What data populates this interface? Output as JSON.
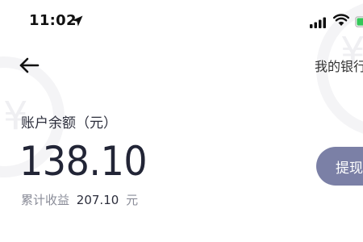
{
  "status_bar": {
    "time": "11:02",
    "icons": [
      "location-arrow-icon",
      "cellular-signal-icon",
      "wifi-icon",
      "battery-icon"
    ]
  },
  "nav": {
    "back_icon": "arrow-left-icon",
    "right_link": "我的银行"
  },
  "balance": {
    "label": "账户余额（元）",
    "amount": "138.10",
    "earnings_label": "累计收益",
    "earnings_value": "207.10",
    "earnings_unit": "元"
  },
  "actions": {
    "withdraw_label": "提现"
  },
  "colors": {
    "accent_button": "#7b80a6",
    "text_primary": "#222536",
    "text_secondary": "#8a8c98",
    "battery_green": "#34c759"
  }
}
